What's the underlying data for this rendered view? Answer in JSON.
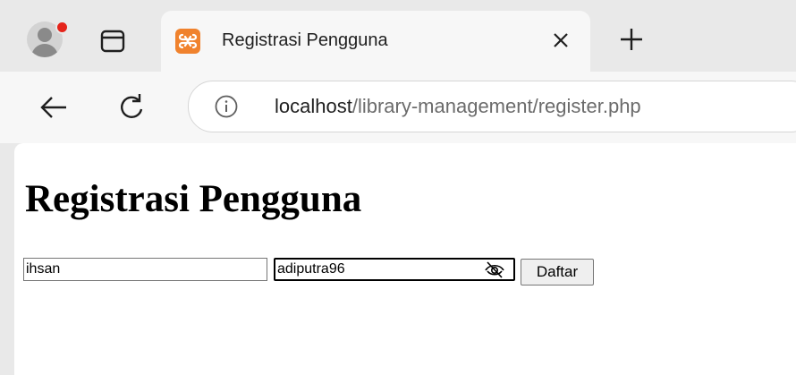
{
  "browser": {
    "tab_title": "Registrasi Pengguna",
    "url_host": "localhost",
    "url_path": "/library-management/register.php",
    "accent_color": "#f0822d"
  },
  "page": {
    "title": "Registrasi Pengguna"
  },
  "form": {
    "username_value": "ihsan",
    "password_value": "adiputra96",
    "submit_label": "Daftar"
  },
  "icons": {
    "profile": "profile-avatar-icon",
    "tab_actions": "tab-actions-icon",
    "favicon": "xampp-favicon-icon",
    "close": "close-icon",
    "new_tab": "plus-icon",
    "back": "back-arrow-icon",
    "reload": "reload-icon",
    "site_info": "info-icon",
    "reveal_password": "eye-off-icon"
  }
}
